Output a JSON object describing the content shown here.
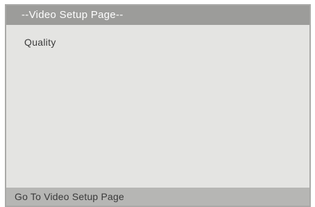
{
  "header": {
    "title": "--Video Setup Page--"
  },
  "menu": {
    "items": [
      {
        "label": "Quality"
      }
    ]
  },
  "status_bar": {
    "text": "Go To Video Setup Page"
  },
  "colors": {
    "title_bar_bg": "#9c9c9a",
    "content_bg": "#e4e4e2",
    "status_bar_bg": "#b6b6b4",
    "title_text": "#ffffff",
    "body_text": "#3a3a3a"
  }
}
